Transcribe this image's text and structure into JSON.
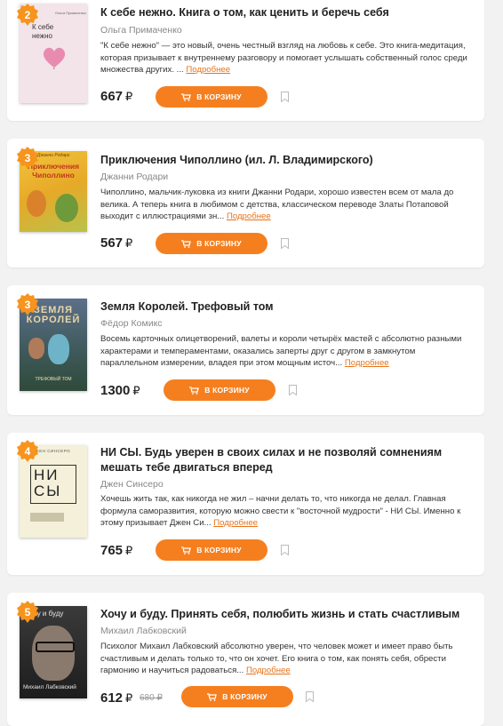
{
  "currency": "₽",
  "cart_label": "В КОРЗИНУ",
  "more_label": "Подробнее",
  "books": [
    {
      "rank": "2",
      "title": "К себе нежно. Книга о том, как ценить и беречь себя",
      "author": "Ольга Примаченко",
      "description": "\"К себе нежно\" — это новый, очень честный взгляд на любовь к себе. Это книга-медитация, которая призывает к внутреннему разговору и помогает услышать собственный голос среди множества других. ...",
      "price": "667",
      "cover_text": "К себе нежно",
      "cover_author": "Ольга Примаченко"
    },
    {
      "rank": "3",
      "title": "Приключения Чиполлино (ил. Л. Владимирского)",
      "author": "Джанни Родари",
      "description": "Чиполлино, мальчик-луковка из книги Джанни Родари, хорошо известен всем от мала до велика. А теперь книга в любимом с детства, классическом переводе Златы Потаповой выходит с иллюстрациями зн...",
      "price": "567",
      "cover_text": "Приключения Чиполлино",
      "cover_author": "Джанни Родари"
    },
    {
      "rank": "3",
      "title": "Земля Королей. Трефовый том",
      "author": "Фёдор Комикс",
      "description": "Восемь карточных олицетворений, валеты и короли четырёх мастей с абсолютно разными характерами и темпераментами, оказались заперты друг с другом в замкнутом параллельном измерении, владея при этом мощным источ...",
      "price": "1300",
      "cover_text": "ЗЕМЛЯ КОРОЛЕЙ",
      "cover_sub": "ТРЕФОВЫЙ ТОМ"
    },
    {
      "rank": "4",
      "title": "НИ СЫ. Будь уверен в своих силах и не позволяй сомнениям мешать тебе двигаться вперед",
      "author": "Джен Синсеро",
      "description": "Хочешь жить так, как никогда не жил – начни делать то, что никогда не делал. Главная формула саморазвития, которую можно свести к \"восточной мудрости\" - НИ СЫ. Именно к этому призывает Джен Си...",
      "price": "765",
      "cover_top": "ДЖЕН СИНСЕРО",
      "cover_text_1": "НИ",
      "cover_text_2": "СЫ"
    },
    {
      "rank": "5",
      "title": "Хочу и буду. Принять себя, полюбить жизнь и стать счастливым",
      "author": "Михаил Лабковский",
      "description": "Психолог Михаил Лабковский абсолютно уверен, что человек может и имеет право быть счастливым и делать только то, что он хочет. Его книга о том, как понять себя, обрести гармонию и научиться радоваться...",
      "price": "612",
      "old_price": "680 ₽",
      "cover_text": "Хочу и буду",
      "cover_author": "Михаил Лабковский"
    }
  ]
}
